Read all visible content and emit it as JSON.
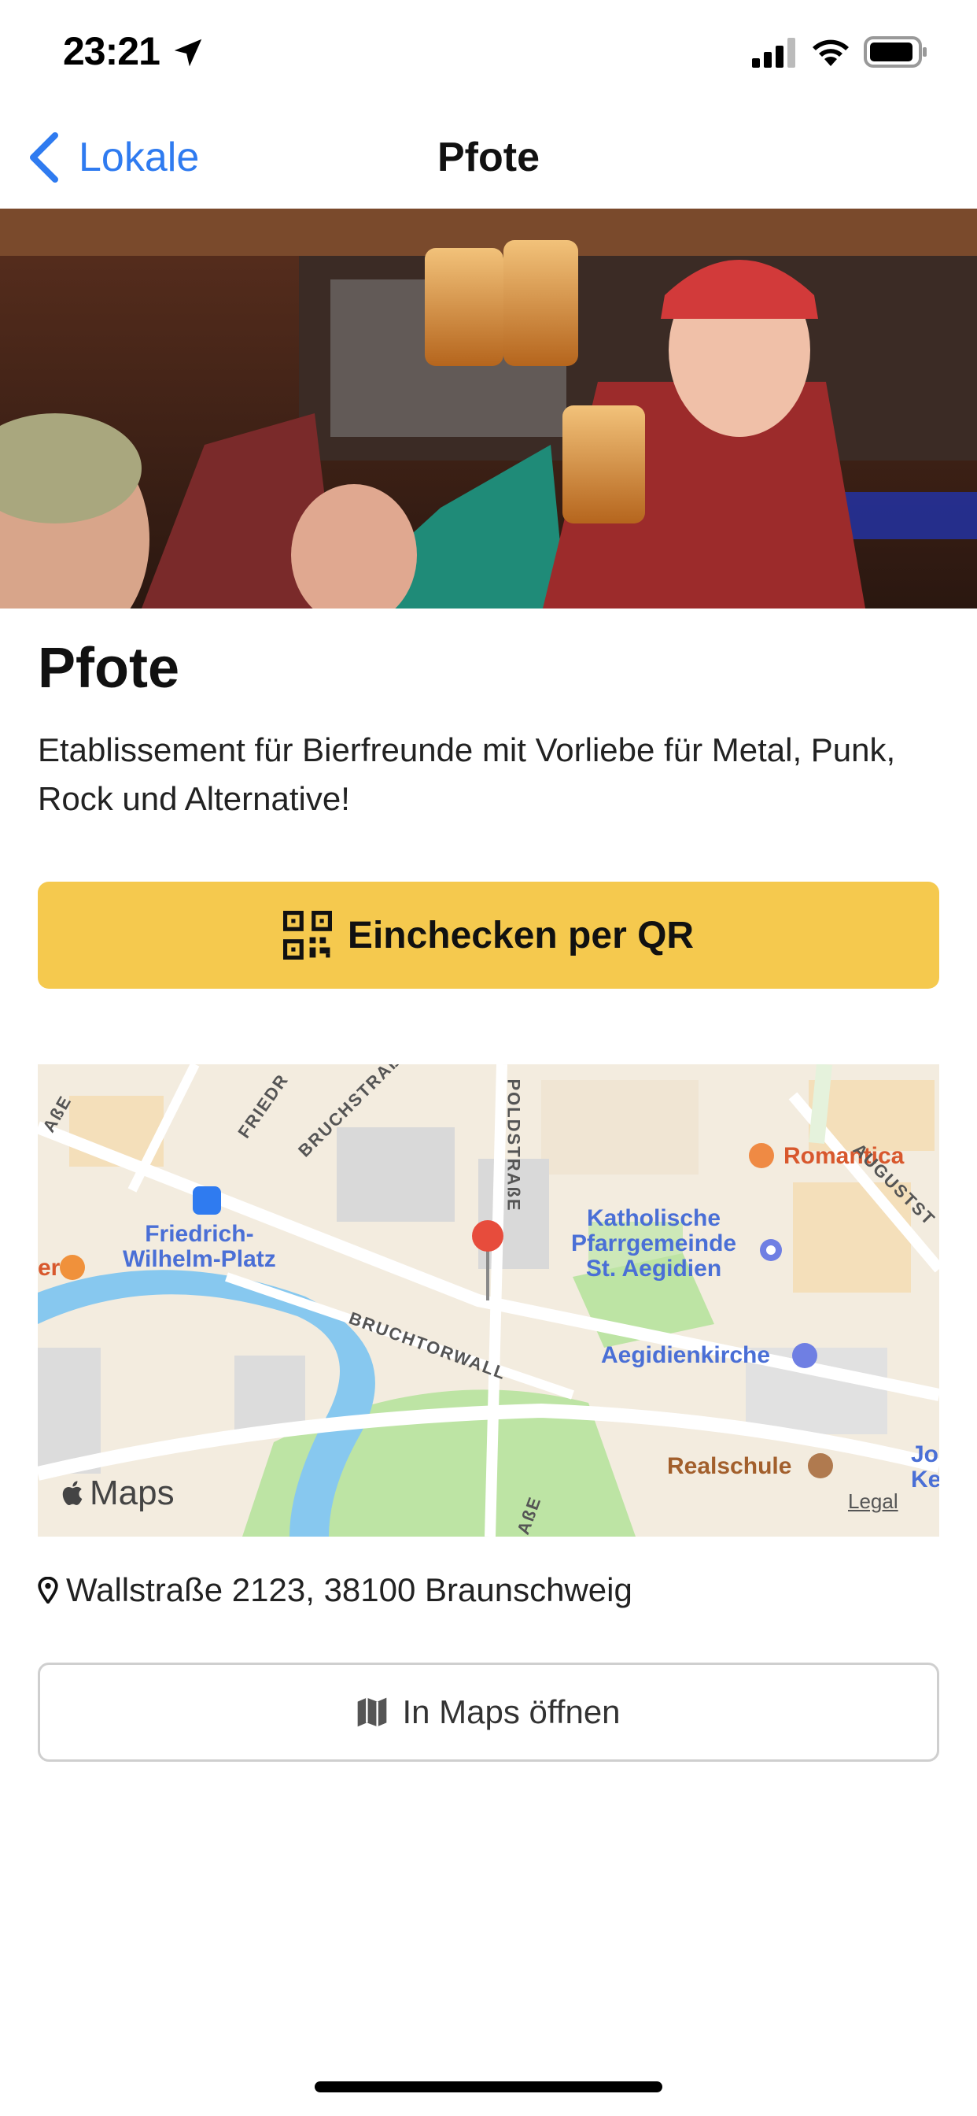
{
  "status_bar": {
    "time": "23:21"
  },
  "nav": {
    "back_label": "Lokale",
    "title": "Pfote"
  },
  "venue": {
    "name": "Pfote",
    "description": "Etablissement für Bierfreunde mit Vorliebe für Metal, Punk, Rock und Alternative!",
    "checkin_label": "Einchecken per QR",
    "address": "Wallstraße 2123, 38100 Braunschweig",
    "open_maps_label": "In Maps öffnen"
  },
  "map": {
    "labels": {
      "friedrich_wilhelm_platz": "Friedrich-\nWilhelm-Platz",
      "katholische": "Katholische\nPfarrgemeinde\nSt. Aegidien",
      "aegidienkirche": "Aegidienkirche",
      "romantica": "Romantica",
      "realschule": "Realschule",
      "bruchtorwall": "BRUCHTORWALL",
      "poldstrasse": "POLDSTRAßE",
      "bruchstrasse": "BRUCHSTRAß",
      "friedr": "FRIEDR",
      "augustst": "AUGUSTST",
      "asse_left": "AßE",
      "asse_bottom": "AßE",
      "jo_kenn": "Jo\nKenn",
      "er": "er"
    },
    "brand": "Maps",
    "legal": "Legal"
  },
  "colors": {
    "accent": "#2f7bf0",
    "checkin_bg": "#f5c94e",
    "pin": "#e74c3c"
  }
}
